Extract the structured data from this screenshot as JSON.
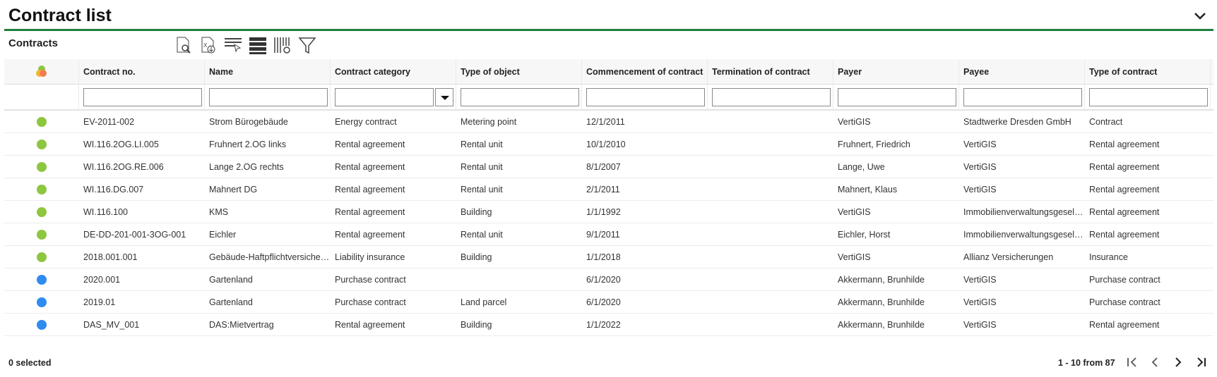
{
  "title": "Contract list",
  "subtitle": "Contracts",
  "toolbar": [
    "document-search-icon",
    "excel-export-icon",
    "row-select-icon",
    "row-height-icon",
    "column-settings-icon",
    "filter-icon"
  ],
  "columns": [
    "",
    "Contract no.",
    "Name",
    "Contract category",
    "Type of object",
    "Commencement of contract",
    "Termination of contract",
    "Payer",
    "Payee",
    "Type of contract"
  ],
  "colors": {
    "green": "#8dc63f",
    "blue": "#2e8bf0",
    "accent": "#1e7f3e"
  },
  "rows": [
    {
      "status": "green",
      "c": [
        "EV-2011-002",
        "Strom Bürogebäude",
        "Energy contract",
        "Metering point",
        "12/1/2011",
        "",
        "VertiGIS",
        "Stadtwerke Dresden GmbH",
        "Contract"
      ]
    },
    {
      "status": "green",
      "c": [
        "WI.116.2OG.LI.005",
        "Fruhnert 2.OG links",
        "Rental agreement",
        "Rental unit",
        "10/1/2010",
        "",
        "Fruhnert, Friedrich",
        "VertiGIS",
        "Rental agreement"
      ]
    },
    {
      "status": "green",
      "c": [
        "WI.116.2OG.RE.006",
        "Lange 2.OG rechts",
        "Rental agreement",
        "Rental unit",
        "8/1/2007",
        "",
        "Lange, Uwe",
        "VertiGIS",
        "Rental agreement"
      ]
    },
    {
      "status": "green",
      "c": [
        "WI.116.DG.007",
        "Mahnert DG",
        "Rental agreement",
        "Rental unit",
        "2/1/2011",
        "",
        "Mahnert, Klaus",
        "VertiGIS",
        "Rental agreement"
      ]
    },
    {
      "status": "green",
      "c": [
        "WI.116.100",
        "KMS",
        "Rental agreement",
        "Building",
        "1/1/1992",
        "",
        "VertiGIS",
        "Immobilienverwaltungsgesells...",
        "Rental agreement"
      ]
    },
    {
      "status": "green",
      "c": [
        "DE-DD-201-001-3OG-001",
        "Eichler",
        "Rental agreement",
        "Rental unit",
        "9/1/2011",
        "",
        "Eichler, Horst",
        "Immobilienverwaltungsgesells...",
        "Rental agreement"
      ]
    },
    {
      "status": "green",
      "c": [
        "2018.001.001",
        "Gebäude-Haftpflichtversicheru...",
        "Liability insurance",
        "Building",
        "1/1/2018",
        "",
        "VertiGIS",
        "Allianz Versicherungen",
        "Insurance"
      ]
    },
    {
      "status": "blue",
      "c": [
        "2020.001",
        "Gartenland",
        "Purchase contract",
        "",
        "6/1/2020",
        "",
        "Akkermann, Brunhilde",
        "VertiGIS",
        "Purchase contract"
      ]
    },
    {
      "status": "blue",
      "c": [
        "2019.01",
        "Gartenland",
        "Purchase contract",
        "Land parcel",
        "6/1/2020",
        "",
        "Akkermann, Brunhilde",
        "VertiGIS",
        "Purchase contract"
      ]
    },
    {
      "status": "blue",
      "c": [
        "DAS_MV_001",
        "DAS:Mietvertrag",
        "Rental agreement",
        "Building",
        "1/1/2022",
        "",
        "Akkermann, Brunhilde",
        "VertiGIS",
        "Rental agreement"
      ]
    }
  ],
  "footer": {
    "selected": "0 selected",
    "range": "1 - 10 from 87"
  }
}
